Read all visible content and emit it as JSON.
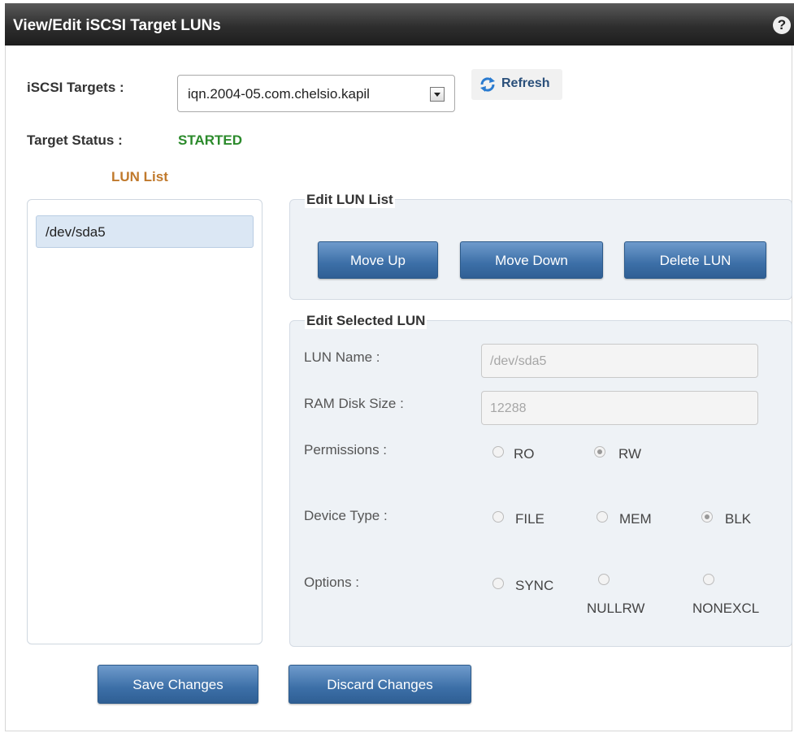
{
  "window": {
    "title": "View/Edit iSCSI Target LUNs",
    "help": "?"
  },
  "targets": {
    "label": "iSCSI Targets :",
    "selected": "iqn.2004-05.com.chelsio.kapil"
  },
  "refresh": {
    "label": "Refresh"
  },
  "status": {
    "label": "Target Status :",
    "value": "STARTED"
  },
  "lun_list": {
    "title": "LUN List",
    "items": [
      "/dev/sda5"
    ]
  },
  "edit_lun_list": {
    "legend": "Edit LUN List",
    "move_up": "Move Up",
    "move_down": "Move Down",
    "delete": "Delete LUN"
  },
  "edit_selected": {
    "legend": "Edit Selected LUN",
    "lun_name_label": "LUN Name :",
    "lun_name_value": "/dev/sda5",
    "ram_label": "RAM Disk Size :",
    "ram_value": "12288",
    "perm_label": "Permissions :",
    "perm_options": [
      "RO",
      "RW"
    ],
    "perm_selected": "RW",
    "device_label": "Device Type :",
    "device_options": [
      "FILE",
      "MEM",
      "BLK"
    ],
    "device_selected": "BLK",
    "options_label": "Options :",
    "options": [
      "SYNC",
      "NULLRW",
      "NONEXCL"
    ]
  },
  "footer": {
    "save": "Save Changes",
    "discard": "Discard Changes"
  },
  "colors": {
    "status": "#2b8a2b",
    "lun_title": "#c0792c",
    "button": "#3c6fa7"
  }
}
